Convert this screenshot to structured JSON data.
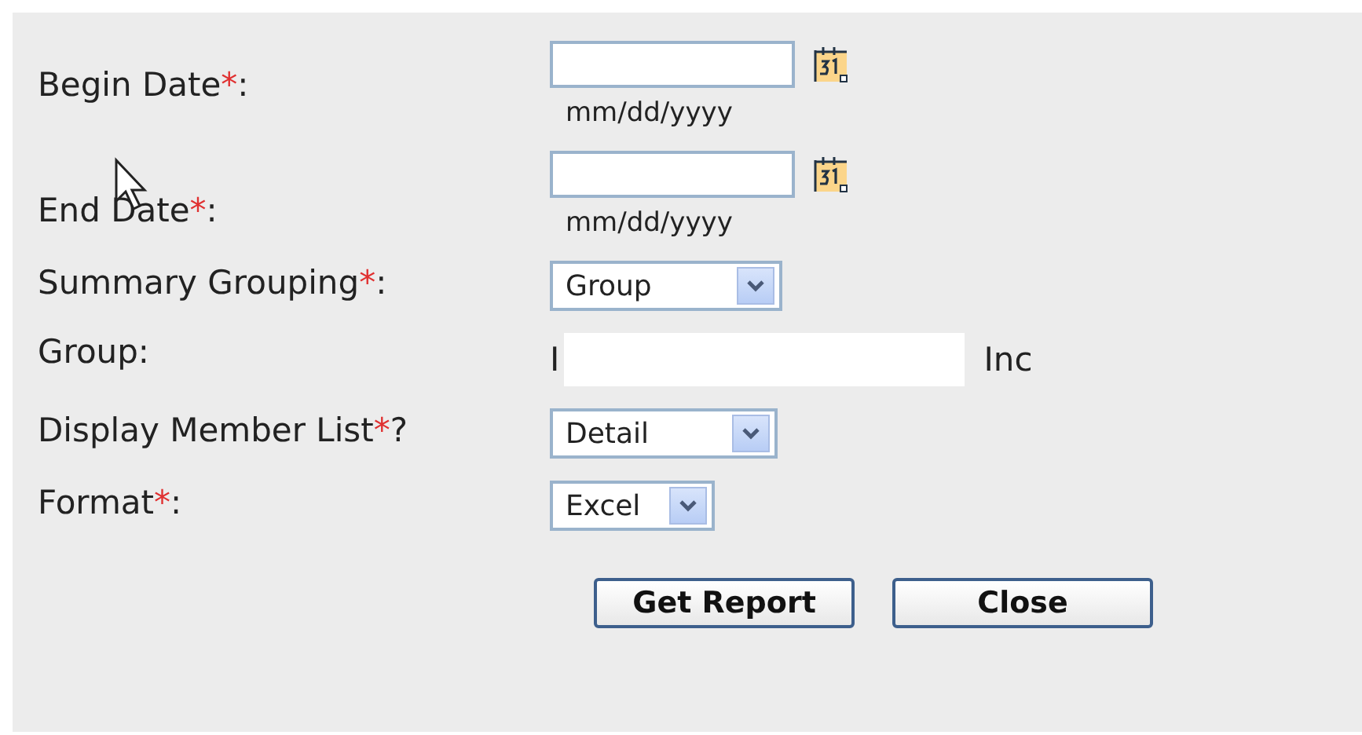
{
  "fields": [
    {
      "kind": "date",
      "label": "Begin Date",
      "mark": "*",
      "suffix": ":",
      "hint": "mm/dd/yyyy"
    },
    {
      "kind": "date",
      "label": "End Date",
      "mark": "*",
      "suffix": ":",
      "hint": "mm/dd/yyyy"
    },
    {
      "kind": "select",
      "label": "Summary Grouping",
      "mark": "*",
      "suffix": ":",
      "value": "Group"
    },
    {
      "kind": "text",
      "label": "Group:",
      "value": "I",
      "after": "Inc"
    },
    {
      "kind": "select",
      "label": "Display Member List",
      "mark": "*",
      "suffix": "?",
      "value": "Detail"
    },
    {
      "kind": "select",
      "label": "Format",
      "mark": "*",
      "suffix": ":",
      "value": "Excel"
    }
  ],
  "buttons": [
    "Get Report",
    "Close"
  ]
}
